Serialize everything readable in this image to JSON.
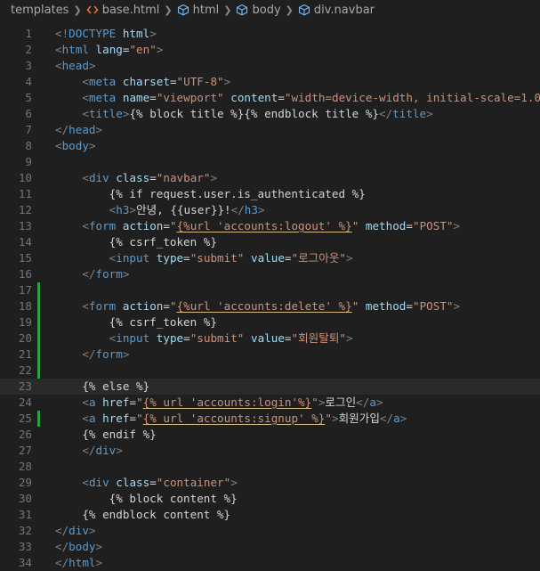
{
  "breadcrumb": {
    "items": [
      "templates",
      "base.html",
      "html",
      "body",
      "div.navbar"
    ]
  },
  "editor": {
    "current_line": 23,
    "modified_lines": [
      17,
      18,
      19,
      20,
      21,
      22,
      25
    ],
    "lines": [
      [
        [
          "pun",
          "<!"
        ],
        [
          "tag",
          "DOCTYPE"
        ],
        [
          "txt",
          " "
        ],
        [
          "att",
          "html"
        ],
        [
          "pun",
          ">"
        ]
      ],
      [
        [
          "pun",
          "<"
        ],
        [
          "tag",
          "html"
        ],
        [
          "txt",
          " "
        ],
        [
          "att",
          "lang"
        ],
        [
          "txt",
          "="
        ],
        [
          "str",
          "\"en\""
        ],
        [
          "pun",
          ">"
        ]
      ],
      [
        [
          "pun",
          "<"
        ],
        [
          "tag",
          "head"
        ],
        [
          "pun",
          ">"
        ]
      ],
      [
        [
          "txt",
          "    "
        ],
        [
          "pun",
          "<"
        ],
        [
          "tag",
          "meta"
        ],
        [
          "txt",
          " "
        ],
        [
          "att",
          "charset"
        ],
        [
          "txt",
          "="
        ],
        [
          "str",
          "\"UTF-8\""
        ],
        [
          "pun",
          ">"
        ]
      ],
      [
        [
          "txt",
          "    "
        ],
        [
          "pun",
          "<"
        ],
        [
          "tag",
          "meta"
        ],
        [
          "txt",
          " "
        ],
        [
          "att",
          "name"
        ],
        [
          "txt",
          "="
        ],
        [
          "str",
          "\"viewport\""
        ],
        [
          "txt",
          " "
        ],
        [
          "att",
          "content"
        ],
        [
          "txt",
          "="
        ],
        [
          "str",
          "\"width=device-width, initial-scale=1.0\""
        ],
        [
          "pun",
          ">"
        ]
      ],
      [
        [
          "txt",
          "    "
        ],
        [
          "pun",
          "<"
        ],
        [
          "tag",
          "title"
        ],
        [
          "pun",
          ">"
        ],
        [
          "txt",
          "{% block title %}{% endblock title %}"
        ],
        [
          "pun",
          "</"
        ],
        [
          "tag",
          "title"
        ],
        [
          "pun",
          ">"
        ]
      ],
      [
        [
          "pun",
          "</"
        ],
        [
          "tag",
          "head"
        ],
        [
          "pun",
          ">"
        ]
      ],
      [
        [
          "pun",
          "<"
        ],
        [
          "tag",
          "body"
        ],
        [
          "pun",
          ">"
        ]
      ],
      [],
      [
        [
          "txt",
          "    "
        ],
        [
          "pun",
          "<"
        ],
        [
          "tag",
          "div"
        ],
        [
          "txt",
          " "
        ],
        [
          "att",
          "class"
        ],
        [
          "txt",
          "="
        ],
        [
          "str",
          "\"navbar\""
        ],
        [
          "pun",
          ">"
        ]
      ],
      [
        [
          "txt",
          "        {% if request.user.is_authenticated %}"
        ]
      ],
      [
        [
          "txt",
          "        "
        ],
        [
          "pun",
          "<"
        ],
        [
          "tag",
          "h3"
        ],
        [
          "pun",
          ">"
        ],
        [
          "txt",
          "안녕, {{user}}!"
        ],
        [
          "pun",
          "</"
        ],
        [
          "tag",
          "h3"
        ],
        [
          "pun",
          ">"
        ]
      ],
      [
        [
          "txt",
          "    "
        ],
        [
          "pun",
          "<"
        ],
        [
          "tag",
          "form"
        ],
        [
          "txt",
          " "
        ],
        [
          "att",
          "action"
        ],
        [
          "txt",
          "="
        ],
        [
          "str",
          "\""
        ],
        [
          "stru",
          "{%url 'accounts:logout' %}"
        ],
        [
          "str",
          "\""
        ],
        [
          "txt",
          " "
        ],
        [
          "att",
          "method"
        ],
        [
          "txt",
          "="
        ],
        [
          "str",
          "\"POST\""
        ],
        [
          "pun",
          ">"
        ]
      ],
      [
        [
          "txt",
          "        {% csrf_token %}"
        ]
      ],
      [
        [
          "txt",
          "        "
        ],
        [
          "pun",
          "<"
        ],
        [
          "tag",
          "input"
        ],
        [
          "txt",
          " "
        ],
        [
          "att",
          "type"
        ],
        [
          "txt",
          "="
        ],
        [
          "str",
          "\"submit\""
        ],
        [
          "txt",
          " "
        ],
        [
          "att",
          "value"
        ],
        [
          "txt",
          "="
        ],
        [
          "str",
          "\"로그아웃\""
        ],
        [
          "pun",
          ">"
        ]
      ],
      [
        [
          "txt",
          "    "
        ],
        [
          "pun",
          "</"
        ],
        [
          "tag",
          "form"
        ],
        [
          "pun",
          ">"
        ]
      ],
      [],
      [
        [
          "txt",
          "    "
        ],
        [
          "pun",
          "<"
        ],
        [
          "tag",
          "form"
        ],
        [
          "txt",
          " "
        ],
        [
          "att",
          "action"
        ],
        [
          "txt",
          "="
        ],
        [
          "str",
          "\""
        ],
        [
          "stru",
          "{%url 'accounts:delete' %}"
        ],
        [
          "str",
          "\""
        ],
        [
          "txt",
          " "
        ],
        [
          "att",
          "method"
        ],
        [
          "txt",
          "="
        ],
        [
          "str",
          "\"POST\""
        ],
        [
          "pun",
          ">"
        ]
      ],
      [
        [
          "txt",
          "        {% csrf_token %}"
        ]
      ],
      [
        [
          "txt",
          "        "
        ],
        [
          "pun",
          "<"
        ],
        [
          "tag",
          "input"
        ],
        [
          "txt",
          " "
        ],
        [
          "att",
          "type"
        ],
        [
          "txt",
          "="
        ],
        [
          "str",
          "\"submit\""
        ],
        [
          "txt",
          " "
        ],
        [
          "att",
          "value"
        ],
        [
          "txt",
          "="
        ],
        [
          "str",
          "\"회원탈퇴\""
        ],
        [
          "pun",
          ">"
        ]
      ],
      [
        [
          "txt",
          "    "
        ],
        [
          "pun",
          "</"
        ],
        [
          "tag",
          "form"
        ],
        [
          "pun",
          ">"
        ]
      ],
      [],
      [
        [
          "txt",
          "    {% else %}"
        ]
      ],
      [
        [
          "txt",
          "    "
        ],
        [
          "pun",
          "<"
        ],
        [
          "tag",
          "a"
        ],
        [
          "txt",
          " "
        ],
        [
          "att",
          "href"
        ],
        [
          "txt",
          "="
        ],
        [
          "str",
          "\""
        ],
        [
          "stru",
          "{% url 'accounts:login'%}"
        ],
        [
          "str",
          "\""
        ],
        [
          "pun",
          ">"
        ],
        [
          "txt",
          "로그인"
        ],
        [
          "pun",
          "</"
        ],
        [
          "tag",
          "a"
        ],
        [
          "pun",
          ">"
        ]
      ],
      [
        [
          "txt",
          "    "
        ],
        [
          "pun",
          "<"
        ],
        [
          "tag",
          "a"
        ],
        [
          "txt",
          " "
        ],
        [
          "att",
          "href"
        ],
        [
          "txt",
          "="
        ],
        [
          "str",
          "\""
        ],
        [
          "stru",
          "{% url 'accounts:signup' %}"
        ],
        [
          "str",
          "\""
        ],
        [
          "pun",
          ">"
        ],
        [
          "txt",
          "회원가입"
        ],
        [
          "pun",
          "</"
        ],
        [
          "tag",
          "a"
        ],
        [
          "pun",
          ">"
        ]
      ],
      [
        [
          "txt",
          "    {% endif %}"
        ]
      ],
      [
        [
          "txt",
          "    "
        ],
        [
          "pun",
          "</"
        ],
        [
          "tag",
          "div"
        ],
        [
          "pun",
          ">"
        ]
      ],
      [],
      [
        [
          "txt",
          "    "
        ],
        [
          "pun",
          "<"
        ],
        [
          "tag",
          "div"
        ],
        [
          "txt",
          " "
        ],
        [
          "att",
          "class"
        ],
        [
          "txt",
          "="
        ],
        [
          "str",
          "\"container\""
        ],
        [
          "pun",
          ">"
        ]
      ],
      [
        [
          "txt",
          "        {% block content %}"
        ]
      ],
      [
        [
          "txt",
          "    {% endblock content %}"
        ]
      ],
      [
        [
          "pun",
          "</"
        ],
        [
          "tag",
          "div"
        ],
        [
          "pun",
          ">"
        ]
      ],
      [
        [
          "pun",
          "</"
        ],
        [
          "tag",
          "body"
        ],
        [
          "pun",
          ">"
        ]
      ],
      [
        [
          "pun",
          "</"
        ],
        [
          "tag",
          "html"
        ],
        [
          "pun",
          ">"
        ]
      ]
    ]
  },
  "colors": {
    "background": "#1f1f1f",
    "tag": "#569cd6",
    "attribute": "#9cdcfe",
    "string": "#ce9178",
    "text": "#d4d4d4",
    "line_number": "#6e7681",
    "git_modified": "#2ea043"
  },
  "icons": {
    "file": "html-file-icon",
    "element": "cube-icon"
  }
}
